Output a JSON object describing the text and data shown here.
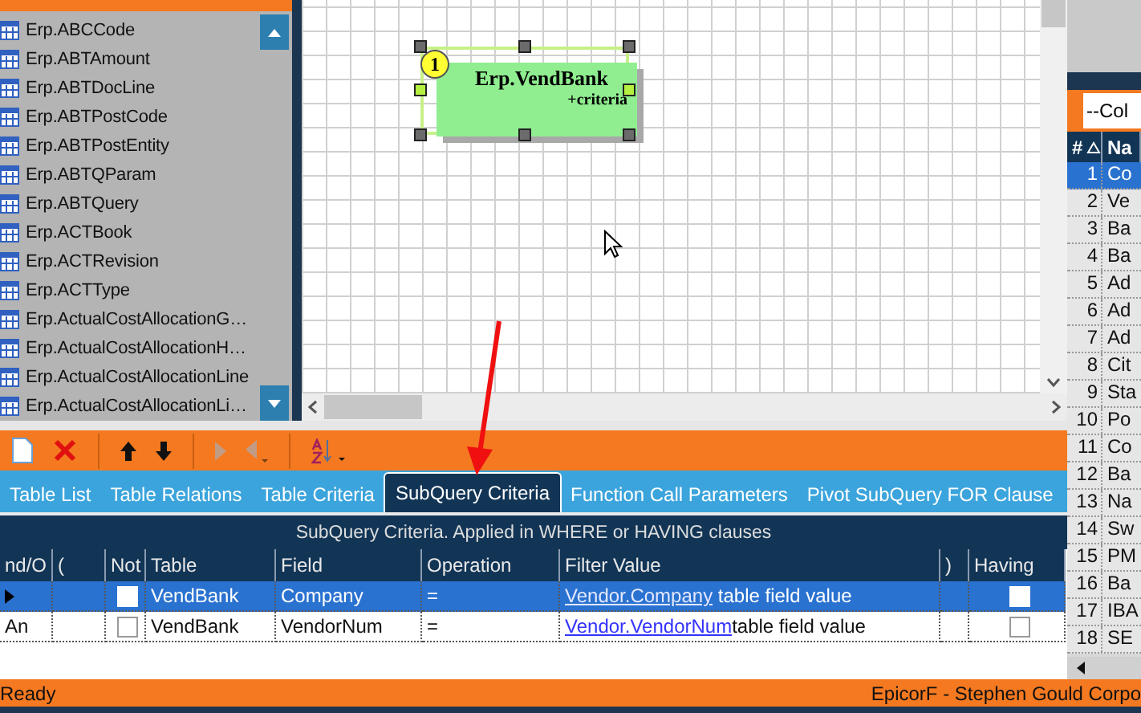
{
  "table_list": {
    "items": [
      {
        "name": "Erp.ABCCode"
      },
      {
        "name": "Erp.ABTAmount"
      },
      {
        "name": "Erp.ABTDocLine"
      },
      {
        "name": "Erp.ABTPostCode"
      },
      {
        "name": "Erp.ABTPostEntity"
      },
      {
        "name": "Erp.ABTQParam"
      },
      {
        "name": "Erp.ABTQuery"
      },
      {
        "name": "Erp.ACTBook"
      },
      {
        "name": "Erp.ACTRevision"
      },
      {
        "name": "Erp.ACTType"
      },
      {
        "name": "Erp.ActualCostAllocationG…"
      },
      {
        "name": "Erp.ActualCostAllocationH…"
      },
      {
        "name": "Erp.ActualCostAllocationLine"
      },
      {
        "name": "Erp.ActualCostAllocationLi…"
      }
    ]
  },
  "diagram": {
    "node": {
      "number": "1",
      "title": "Erp.VendBank",
      "subtitle": "+criteria",
      "selected": true
    }
  },
  "toolbar": {
    "buttons": [
      {
        "kind": "new",
        "disabled": false
      },
      {
        "kind": "delete",
        "disabled": false
      },
      {
        "kind": "up",
        "disabled": false
      },
      {
        "kind": "down",
        "disabled": false
      },
      {
        "kind": "right",
        "disabled": true
      },
      {
        "kind": "left",
        "disabled": true
      },
      {
        "kind": "sort",
        "disabled": false
      }
    ]
  },
  "tabs": [
    {
      "label": "Table List",
      "selected": false
    },
    {
      "label": "Table Relations",
      "selected": false
    },
    {
      "label": "Table Criteria",
      "selected": false
    },
    {
      "label": "SubQuery Criteria",
      "selected": true
    },
    {
      "label": "Function Call Parameters",
      "selected": false
    },
    {
      "label": "Pivot SubQuery FOR Clause",
      "selected": false
    }
  ],
  "criteria_grid": {
    "caption": "SubQuery Criteria. Applied in WHERE or HAVING clauses",
    "columns": [
      "nd/O",
      "(",
      "Not",
      "Table",
      "Field",
      "Operation",
      "Filter Value",
      ")",
      "Having"
    ],
    "rows": [
      {
        "and_or": "",
        "not": false,
        "table": "VendBank",
        "field": "Company",
        "operation": "=",
        "filter_link": "Vendor.Company",
        "filter_text": "table field value",
        "having": false,
        "selected": true
      },
      {
        "and_or": "An",
        "not": false,
        "table": "VendBank",
        "field": "VendorNum",
        "operation": "=",
        "filter_link": "Vendor.VendorNum",
        "filter_text": "table field value",
        "having": false,
        "selected": false
      }
    ]
  },
  "column_list": {
    "filter": "--Col",
    "headers": [
      "#",
      "Na"
    ],
    "rows": [
      {
        "number": "1",
        "name": "Co",
        "selected": true
      },
      {
        "number": "2",
        "name": "Ve",
        "selected": false
      },
      {
        "number": "3",
        "name": "Ba",
        "selected": false
      },
      {
        "number": "4",
        "name": "Ba",
        "selected": false
      },
      {
        "number": "5",
        "name": "Ad",
        "selected": false
      },
      {
        "number": "6",
        "name": "Ad",
        "selected": false
      },
      {
        "number": "7",
        "name": "Ad",
        "selected": false
      },
      {
        "number": "8",
        "name": "Cit",
        "selected": false
      },
      {
        "number": "9",
        "name": "Sta",
        "selected": false
      },
      {
        "number": "10",
        "name": "Po",
        "selected": false
      },
      {
        "number": "11",
        "name": "Co",
        "selected": false
      },
      {
        "number": "12",
        "name": "Ba",
        "selected": false
      },
      {
        "number": "13",
        "name": "Na",
        "selected": false
      },
      {
        "number": "14",
        "name": "Sw",
        "selected": false
      },
      {
        "number": "15",
        "name": "PM",
        "selected": false
      },
      {
        "number": "16",
        "name": "Ba",
        "selected": false
      },
      {
        "number": "17",
        "name": "IBA",
        "selected": false
      },
      {
        "number": "18",
        "name": "SE",
        "selected": false
      }
    ]
  },
  "status_bar": {
    "left": "Ready",
    "right": "EpicorF - Stephen Gould Corpo"
  }
}
